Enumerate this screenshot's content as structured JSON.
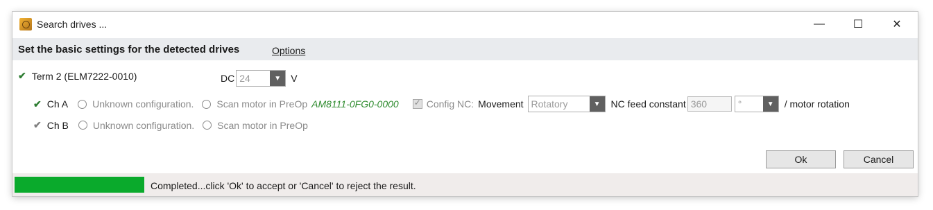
{
  "window": {
    "title": "Search drives ..."
  },
  "controls": {
    "minimize": "—",
    "maximize": "☐",
    "close": "✕"
  },
  "header": {
    "title": "Set the basic settings for the detected drives",
    "options_link": "Options"
  },
  "term": {
    "label": "Term 2 (ELM7222-0010)",
    "dc_label": "DC",
    "dc_value": "24",
    "unit": "V"
  },
  "channels": [
    {
      "label": "Ch A",
      "option_unknown": "Unknown configuration.",
      "option_scan": "Scan motor in PreOp",
      "motor": "AM8111-0FG0-0000",
      "config_nc_label": "Config NC:",
      "movement_label": "Movement",
      "movement_value": "Rotatory",
      "feed_label": "NC feed constant",
      "feed_value": "360",
      "feed_unit_value": "°",
      "per_rotation": "/ motor rotation"
    },
    {
      "label": "Ch B",
      "option_unknown": "Unknown configuration.",
      "option_scan": "Scan motor in PreOp"
    }
  ],
  "buttons": {
    "ok": "Ok",
    "cancel": "Cancel"
  },
  "status": {
    "progress_fraction": 1.0,
    "progress_color": "#0aaa2c",
    "text": "Completed...click 'Ok' to accept or 'Cancel' to reject the result."
  },
  "icons": {
    "app": "drive-search-icon",
    "check": "checkmark-icon",
    "dropdown": "chevron-down-icon"
  }
}
